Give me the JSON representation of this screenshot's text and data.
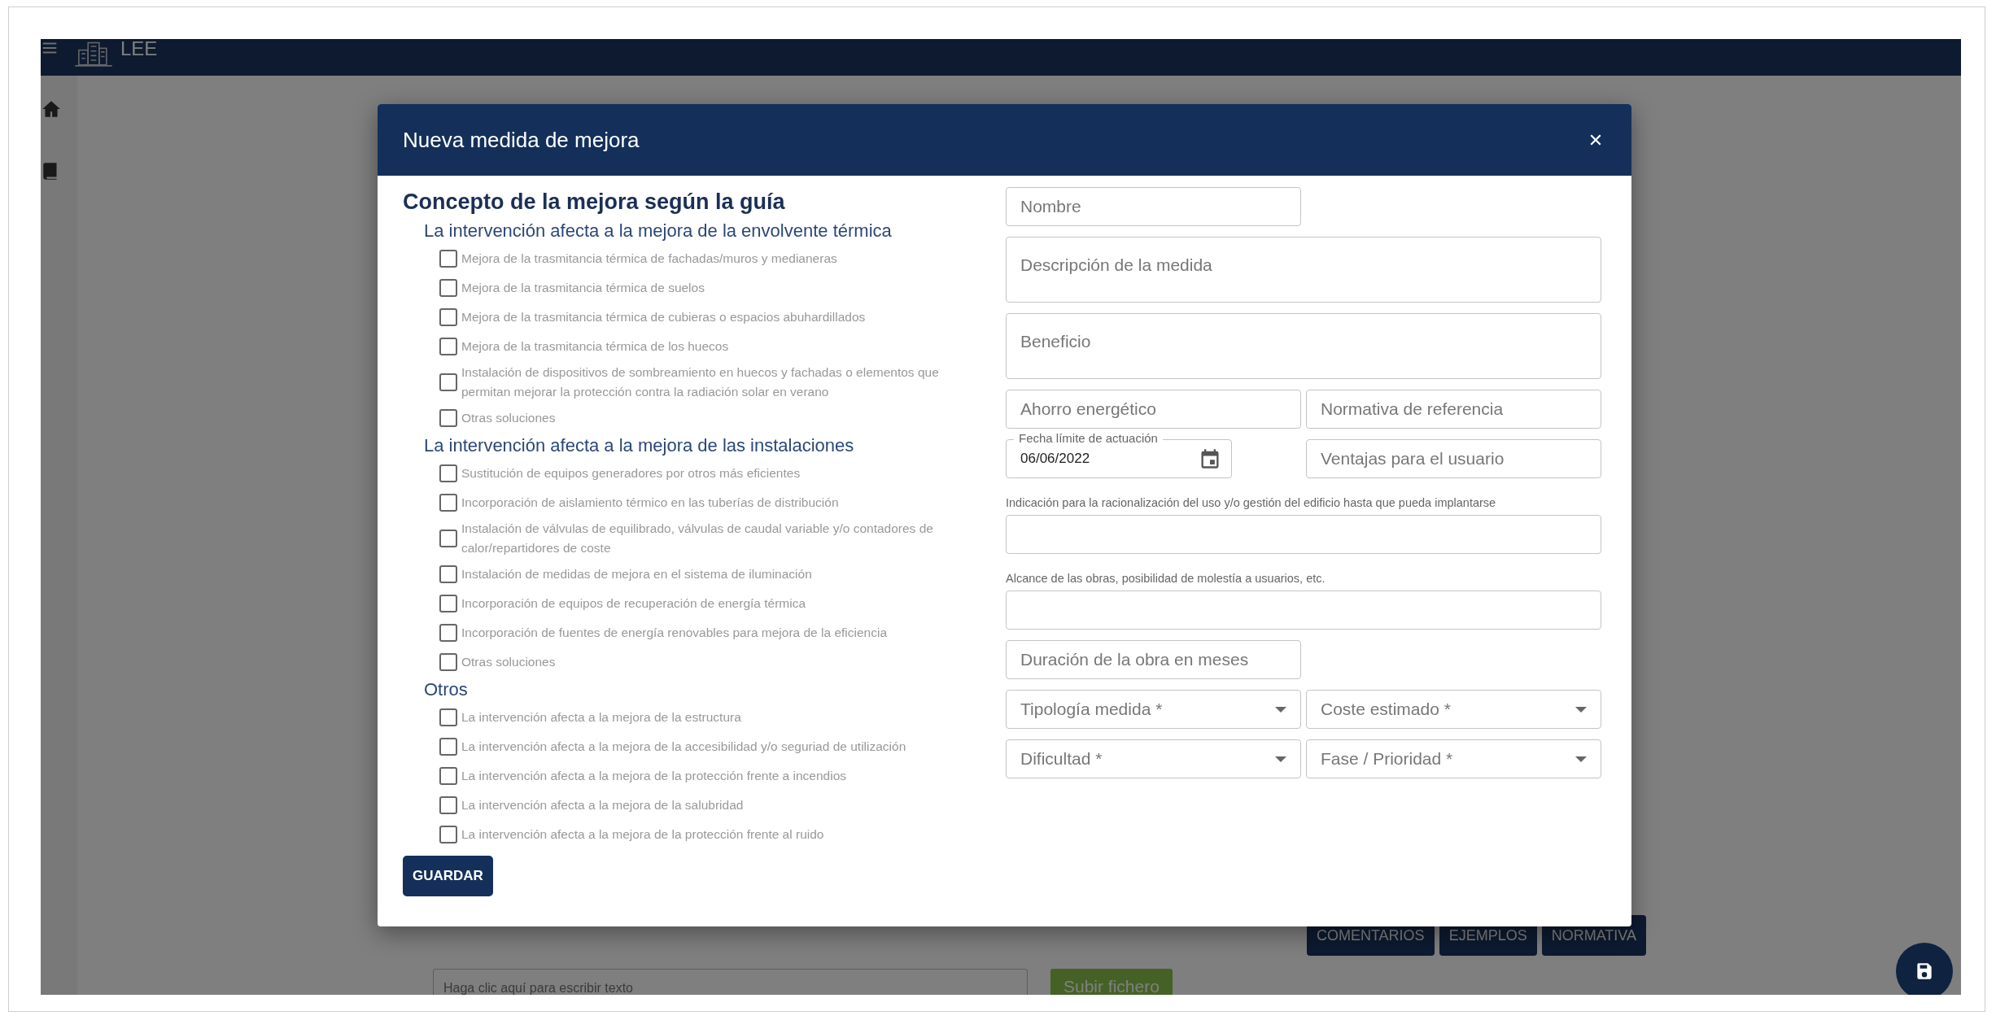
{
  "app": {
    "title": "LEE"
  },
  "background": {
    "buttons": [
      "COMENTARIOS",
      "EJEMPLOS",
      "NORMATIVA"
    ],
    "text_field": {
      "placeholder": "Haga clic aquí para escribir texto"
    },
    "upload_button": "Subir fichero"
  },
  "dialog": {
    "title": "Nueva medida de mejora",
    "concept": {
      "heading": "Concepto de la mejora según la guía",
      "groups": [
        {
          "title": "La intervención afecta a la mejora de la envolvente térmica",
          "options": [
            {
              "label": "Mejora de la trasmitancia térmica de fachadas/muros y medianeras",
              "checked": false
            },
            {
              "label": "Mejora de la trasmitancia térmica de suelos",
              "checked": false
            },
            {
              "label": "Mejora de la trasmitancia térmica de cubieras o espacios abuhardillados",
              "checked": false
            },
            {
              "label": "Mejora de la trasmitancia térmica de los huecos",
              "checked": false
            },
            {
              "label": "Instalación de dispositivos de sombreamiento en huecos y fachadas o elementos que permitan mejorar la protección contra la radiación solar en verano",
              "checked": false
            },
            {
              "label": "Otras soluciones",
              "checked": false
            }
          ]
        },
        {
          "title": "La intervención afecta a la mejora de las instalaciones",
          "options": [
            {
              "label": "Sustitución de equipos generadores por otros más eficientes",
              "checked": false
            },
            {
              "label": "Incorporación de aislamiento térmico en las tuberías de distribución",
              "checked": false
            },
            {
              "label": "Instalación de válvulas de equilibrado, válvulas de caudal variable y/o contadores de calor/repartidores de coste",
              "checked": false
            },
            {
              "label": "Instalación de medidas de mejora en el sistema de iluminación",
              "checked": false
            },
            {
              "label": "Incorporación de equipos de recuperación de energía térmica",
              "checked": false
            },
            {
              "label": "Incorporación de fuentes de energía renovables para mejora de la eficiencia",
              "checked": false
            },
            {
              "label": "Otras soluciones",
              "checked": false
            }
          ]
        },
        {
          "title": "Otros",
          "options": [
            {
              "label": "La intervención afecta a la mejora de la estructura",
              "checked": false
            },
            {
              "label": "La intervención afecta a la mejora de la accesibilidad y/o seguriad de utilización",
              "checked": false
            },
            {
              "label": "La intervención afecta a la mejora de la protección frente a incendios",
              "checked": false
            },
            {
              "label": "La intervención afecta a la mejora de la salubridad",
              "checked": false
            },
            {
              "label": "La intervención afecta a la mejora de la protección frente al ruido",
              "checked": false
            }
          ]
        }
      ]
    },
    "form_rows": [
      {
        "fields": [
          {
            "kind": "text",
            "placeholder": "Nombre"
          }
        ]
      },
      {
        "fields": [
          {
            "kind": "textarea",
            "placeholder": "Descripción de la medida"
          }
        ]
      },
      {
        "fields": [
          {
            "kind": "textarea",
            "placeholder": "Beneficio"
          }
        ]
      },
      {
        "fields": [
          {
            "kind": "text",
            "placeholder": "Ahorro energético"
          },
          {
            "kind": "text",
            "placeholder": "Normativa de referencia"
          }
        ]
      },
      {
        "fields": [
          {
            "kind": "date",
            "label": "Fecha límite de actuación",
            "value": "06/06/2022"
          },
          {
            "kind": "text",
            "placeholder": "Ventajas para el usuario"
          }
        ]
      },
      {
        "fields": [
          {
            "kind": "labeled",
            "label": "Indicación para la racionalización del uso y/o gestión del edificio hasta que pueda implantarse"
          }
        ]
      },
      {
        "fields": [
          {
            "kind": "labeled",
            "label": "Alcance de las obras, posibilidad de molestía a usuarios, etc."
          }
        ]
      },
      {
        "fields": [
          {
            "kind": "text",
            "placeholder": "Duración de la obra en meses"
          }
        ]
      },
      {
        "fields": [
          {
            "kind": "select",
            "placeholder": "Tipología medida *"
          },
          {
            "kind": "select",
            "placeholder": "Coste estimado *"
          }
        ]
      },
      {
        "fields": [
          {
            "kind": "select",
            "placeholder": "Dificultad *"
          },
          {
            "kind": "select",
            "placeholder": "Fase / Prioridad *"
          }
        ]
      }
    ],
    "save_button": "GUARDAR"
  }
}
